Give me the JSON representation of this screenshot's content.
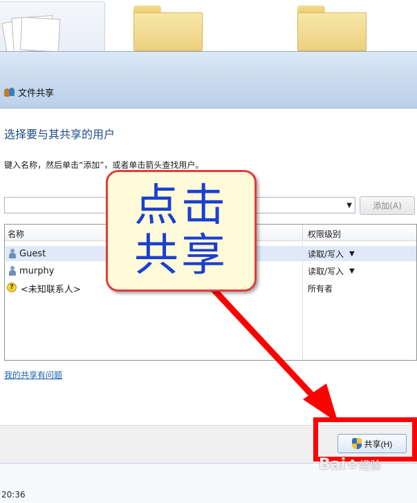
{
  "dialog": {
    "title": "文件共享",
    "heading": "选择要与其共享的用户",
    "instruction": "键入名称，然后单击“添加”，或者单击箭头查找用户。",
    "add_button_label": "添加(A)",
    "share_button_label": "共享(H)",
    "problem_link": "我的共享有问题"
  },
  "user_list": {
    "columns": {
      "name": "名称",
      "permission": "权限级别"
    },
    "rows": [
      {
        "name": "Guest",
        "permission": "读取/写入",
        "has_dropdown": true,
        "selected": true
      },
      {
        "name": "murphy",
        "permission": "读取/写入",
        "has_dropdown": true,
        "selected": false
      },
      {
        "name": "<未知联系人>",
        "permission": "所有者",
        "has_dropdown": false,
        "selected": false
      }
    ]
  },
  "annotation": {
    "callout_line1": "点击",
    "callout_line2": "共享",
    "highlight_color": "#ff0000",
    "text_color": "#1b3fd0"
  },
  "taskbar": {
    "time": "20:36"
  },
  "watermark": {
    "brand": "Bai",
    "brand_suffix": "经验"
  },
  "icons": {
    "dialog_icon": "file-share-icon",
    "user_icon": "user-icon",
    "unknown_contact_icon": "unknown-contact-icon",
    "shield_icon": "uac-shield-icon",
    "dropdown_icon": "chevron-down-icon"
  }
}
